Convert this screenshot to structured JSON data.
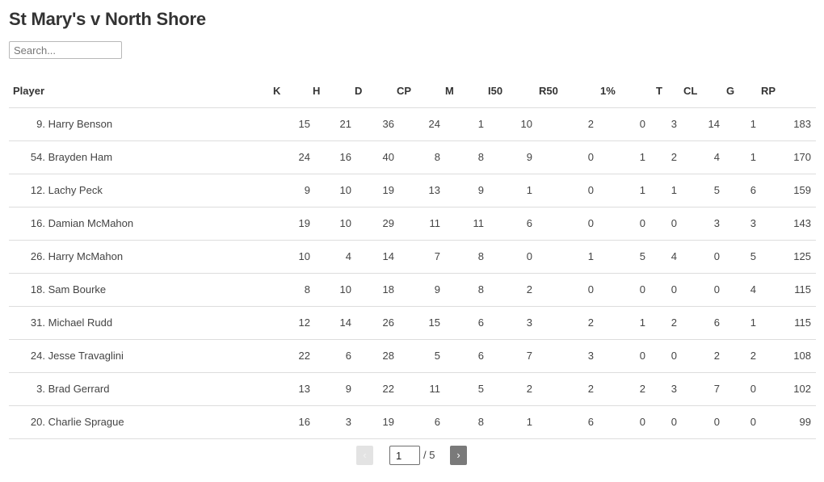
{
  "page": {
    "title": "St Mary's v North Shore"
  },
  "search": {
    "placeholder": "Search...",
    "value": ""
  },
  "table": {
    "columns": [
      "Player",
      "K",
      "H",
      "D",
      "CP",
      "M",
      "I50",
      "R50",
      "1%",
      "T",
      "CL",
      "G",
      "RP"
    ],
    "rows": [
      {
        "num": "9.",
        "name": "Harry Benson",
        "stats": [
          15,
          21,
          36,
          24,
          1,
          10,
          2,
          0,
          3,
          14,
          1,
          183
        ]
      },
      {
        "num": "54.",
        "name": "Brayden Ham",
        "stats": [
          24,
          16,
          40,
          8,
          8,
          9,
          0,
          1,
          2,
          4,
          1,
          170
        ]
      },
      {
        "num": "12.",
        "name": "Lachy Peck",
        "stats": [
          9,
          10,
          19,
          13,
          9,
          1,
          0,
          1,
          1,
          5,
          6,
          159
        ]
      },
      {
        "num": "16.",
        "name": "Damian McMahon",
        "stats": [
          19,
          10,
          29,
          11,
          11,
          6,
          0,
          0,
          0,
          3,
          3,
          143
        ]
      },
      {
        "num": "26.",
        "name": "Harry McMahon",
        "stats": [
          10,
          4,
          14,
          7,
          8,
          0,
          1,
          5,
          4,
          0,
          5,
          125
        ]
      },
      {
        "num": "18.",
        "name": "Sam Bourke",
        "stats": [
          8,
          10,
          18,
          9,
          8,
          2,
          0,
          0,
          0,
          0,
          4,
          115
        ]
      },
      {
        "num": "31.",
        "name": "Michael Rudd",
        "stats": [
          12,
          14,
          26,
          15,
          6,
          3,
          2,
          1,
          2,
          6,
          1,
          115
        ]
      },
      {
        "num": "24.",
        "name": "Jesse Travaglini",
        "stats": [
          22,
          6,
          28,
          5,
          6,
          7,
          3,
          0,
          0,
          2,
          2,
          108
        ]
      },
      {
        "num": "3.",
        "name": "Brad Gerrard",
        "stats": [
          13,
          9,
          22,
          11,
          5,
          2,
          2,
          2,
          3,
          7,
          0,
          102
        ]
      },
      {
        "num": "20.",
        "name": "Charlie Sprague",
        "stats": [
          16,
          3,
          19,
          6,
          8,
          1,
          6,
          0,
          0,
          0,
          0,
          99
        ]
      }
    ]
  },
  "pagination": {
    "prev_icon": "‹",
    "next_icon": "›",
    "current_page": "1",
    "total_label": "/ 5"
  }
}
